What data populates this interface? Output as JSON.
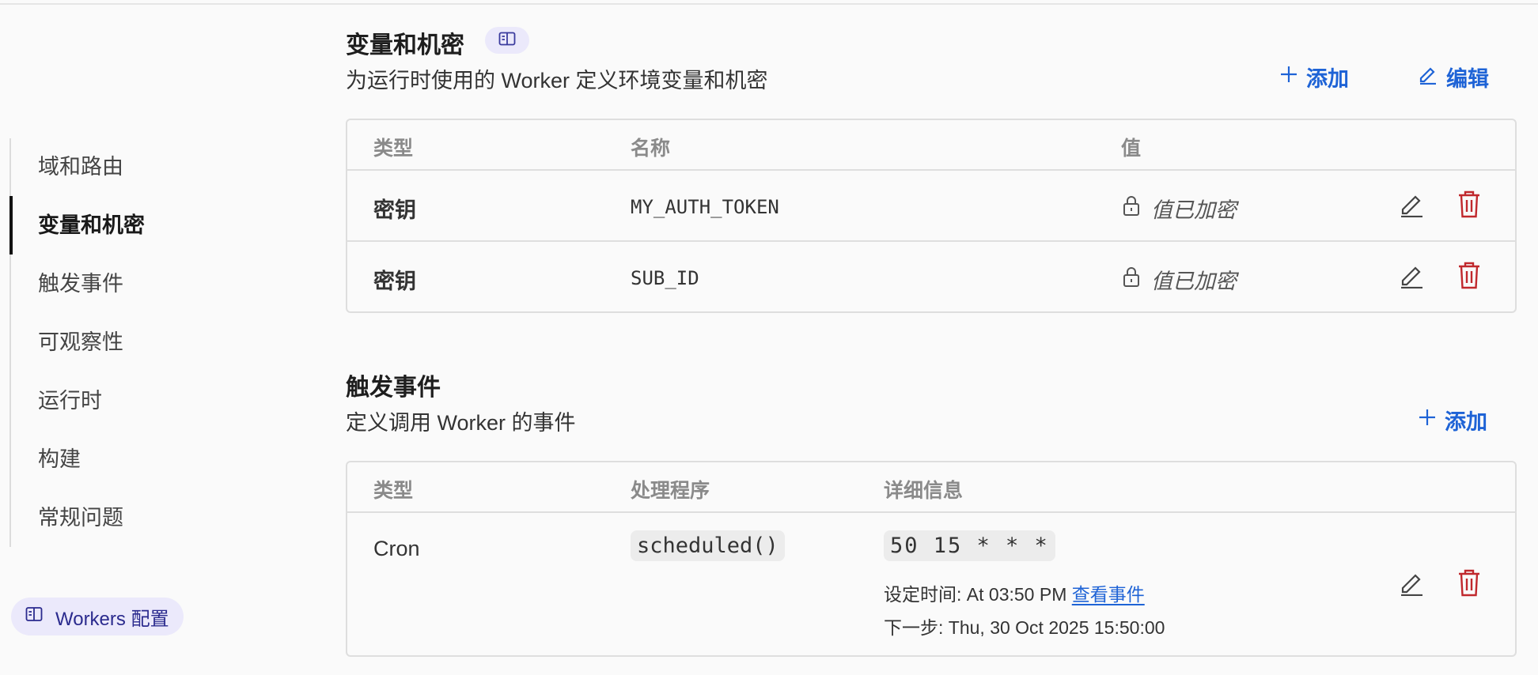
{
  "sidebar": {
    "items": [
      {
        "label": "域和路由"
      },
      {
        "label": "变量和机密"
      },
      {
        "label": "触发事件"
      },
      {
        "label": "可观察性"
      },
      {
        "label": "运行时"
      },
      {
        "label": "构建"
      },
      {
        "label": "常规问题"
      }
    ],
    "active_index": 1,
    "docs_link_label": "Workers 配置"
  },
  "variables": {
    "title": "变量和机密",
    "subtitle": "为运行时使用的 Worker 定义环境变量和机密",
    "add_label": "添加",
    "edit_label": "编辑",
    "columns": [
      "类型",
      "名称",
      "值"
    ],
    "rows": [
      {
        "type": "密钥",
        "name": "MY_AUTH_TOKEN",
        "value": "值已加密"
      },
      {
        "type": "密钥",
        "name": "SUB_ID",
        "value": "值已加密"
      }
    ]
  },
  "triggers": {
    "title": "触发事件",
    "subtitle": "定义调用 Worker 的事件",
    "add_label": "添加",
    "columns": [
      "类型",
      "处理程序",
      "详细信息"
    ],
    "rows": [
      {
        "type": "Cron",
        "handler": "scheduled()",
        "cron": "50 15 * * *",
        "schedule_prefix": "设定时间: At 03:50 PM",
        "view_events_label": "查看事件",
        "next_run": "下一步: Thu, 30 Oct 2025 15:50:00"
      }
    ]
  },
  "colors": {
    "accent": "#1e63d6",
    "danger": "#c0282d",
    "badge_bg": "#ebe9fb"
  }
}
